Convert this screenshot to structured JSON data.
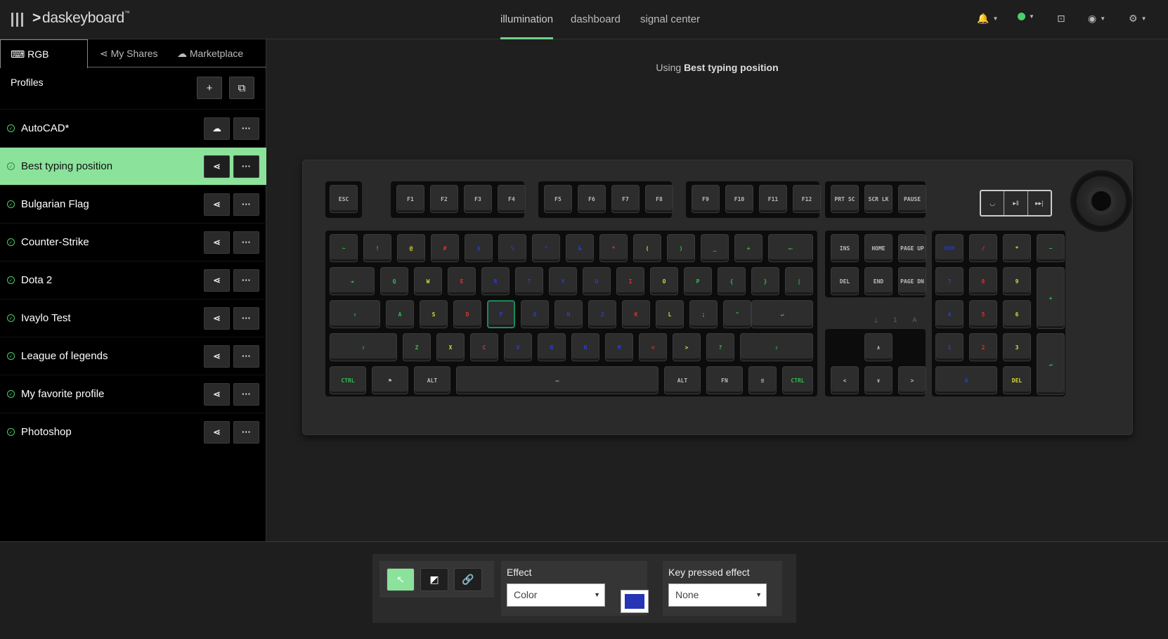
{
  "topbar": {
    "logo": "daskeyboard",
    "logo_mark": "˃",
    "tabs": [
      "illumination",
      "dashboard",
      "signal center"
    ],
    "active_tab": "illumination",
    "icons": [
      "bell-icon",
      "status-dot-icon",
      "screenshot-icon",
      "user-icon",
      "gear-icon"
    ]
  },
  "sidebar": {
    "tabs": [
      {
        "icon": "⌨",
        "label": "RGB Profiles"
      },
      {
        "icon": "⋖",
        "label": "My Shares"
      },
      {
        "icon": "☁",
        "label": "Marketplace"
      }
    ],
    "tools": [
      "+",
      "⧉"
    ],
    "profiles": [
      {
        "name": "AutoCAD*",
        "action": "☁"
      },
      {
        "name": "Best typing position",
        "action": "⋖"
      },
      {
        "name": "Bulgarian Flag",
        "action": "⋖"
      },
      {
        "name": "Counter-Strike",
        "action": "⋖"
      },
      {
        "name": "Dota 2",
        "action": "⋖"
      },
      {
        "name": "Ivaylo Test",
        "action": "⋖"
      },
      {
        "name": "League of legends",
        "action": "⋖"
      },
      {
        "name": "My favorite profile",
        "action": "⋖"
      },
      {
        "name": "Photoshop",
        "action": "⋖"
      }
    ],
    "active_profile": "Best typing position",
    "more": "···",
    "check": "✓"
  },
  "main": {
    "using_prefix": "Using",
    "using_profile": "Best typing position"
  },
  "keyboard": {
    "media": [
      "◡",
      "▸‖",
      "▸▸|"
    ],
    "leds": [
      "⍊",
      "1",
      "A",
      "⍖"
    ],
    "colors": {
      "green": "#2fc24a",
      "yellow": "#d8d83a",
      "red": "#e03030",
      "blue": "#2a3fc8",
      "white": "#bbbbbb",
      "darkblue": "#253aa8"
    }
  },
  "bottom": {
    "tools": [
      "↖",
      "◩",
      "🔗"
    ],
    "effect_label": "Effect",
    "effect_value": "Color",
    "effect_color": "#2535b5",
    "key_pressed_label": "Key pressed effect",
    "key_pressed_value": "None",
    "arrow": "▼"
  }
}
